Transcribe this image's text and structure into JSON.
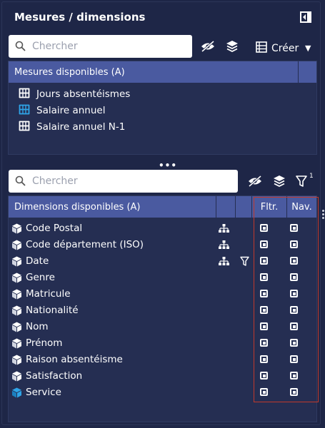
{
  "panel": {
    "title": "Mesures / dimensions"
  },
  "measures": {
    "search_placeholder": "Chercher",
    "create_label": "Créer",
    "header": "Mesures disponibles (A)",
    "items": [
      {
        "label": "Jours absentéismes",
        "icon": "measure-icon",
        "active": false
      },
      {
        "label": "Salaire annuel",
        "icon": "measure-icon",
        "active": true
      },
      {
        "label": "Salaire annuel N-1",
        "icon": "measure-icon",
        "active": false
      }
    ]
  },
  "dimensions": {
    "search_placeholder": "Chercher",
    "filter_count": "1",
    "header": "Dimensions disponibles (A)",
    "col_filter": "Fltr.",
    "col_nav": "Nav.",
    "items": [
      {
        "label": "Code Postal",
        "hierarchy": true,
        "filter": false,
        "active": false
      },
      {
        "label": "Code département (ISO)",
        "hierarchy": true,
        "filter": false,
        "active": false
      },
      {
        "label": "Date",
        "hierarchy": true,
        "filter": true,
        "active": false
      },
      {
        "label": "Genre",
        "hierarchy": false,
        "filter": false,
        "active": false
      },
      {
        "label": "Matricule",
        "hierarchy": false,
        "filter": false,
        "active": false
      },
      {
        "label": "Nationalité",
        "hierarchy": false,
        "filter": false,
        "active": false
      },
      {
        "label": "Nom",
        "hierarchy": false,
        "filter": false,
        "active": false
      },
      {
        "label": "Prénom",
        "hierarchy": false,
        "filter": false,
        "active": false
      },
      {
        "label": "Raison absentéisme",
        "hierarchy": false,
        "filter": false,
        "active": false
      },
      {
        "label": "Satisfaction",
        "hierarchy": false,
        "filter": false,
        "active": false
      },
      {
        "label": "Service",
        "hierarchy": false,
        "filter": false,
        "active": true
      }
    ]
  },
  "colors": {
    "background": "#1e2647",
    "header": "#4a5aa0",
    "accent": "#2fa4e7",
    "highlight_frame": "#c0392b"
  }
}
